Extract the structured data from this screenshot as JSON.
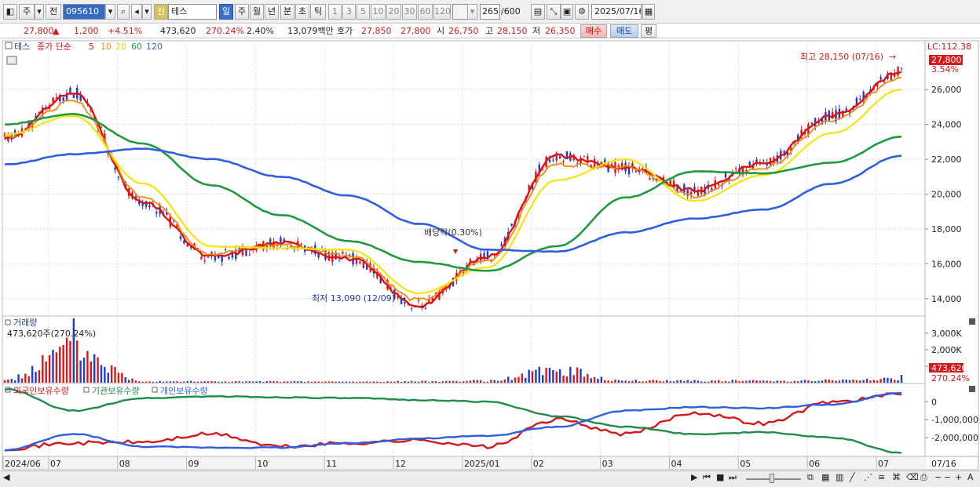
{
  "toolbar": {
    "type_label": "주",
    "prev_label": "전",
    "stock_code": "095610",
    "stock_tag": "신",
    "stock_name": "테스",
    "period_selected": "일",
    "period_tabs": [
      "일",
      "주",
      "월",
      "년",
      "분",
      "초",
      "틱"
    ],
    "interval_tabs": [
      "1",
      "3",
      "5",
      "10",
      "20",
      "30",
      "60",
      "120"
    ],
    "bar_count": "265",
    "bar_total": "/600",
    "date": "2025/07/16"
  },
  "quote": {
    "price": "27,800",
    "change": "1,200",
    "change_pct": "+4.51%",
    "volume": "473,620",
    "volume_pct": "270.24%",
    "turnover_pct": "2.40%",
    "amount": "13,079백만",
    "hoga_label": "호가",
    "ask": "27,850",
    "bid": "27,800",
    "open_label": "시",
    "open": "26,750",
    "high_label": "고",
    "high": "28,150",
    "low_label": "저",
    "low": "26,350",
    "buy_label": "매수",
    "sell_label": "매도",
    "eval_label": "평"
  },
  "price_panel": {
    "name_tag": "테스",
    "legend_title": "종가 단순",
    "ma_periods": [
      "5",
      "10",
      "20",
      "60",
      "120"
    ],
    "ma_colors": [
      "#e01010",
      "#f08a10",
      "#f6e40a",
      "#1f9a3c",
      "#2f5fe0"
    ],
    "lc_label": "LC:112.38",
    "last_price_tag": "27,800",
    "pct_tag": "3.54%",
    "high_note": "최고 28,150 (07/16)",
    "low_note": "최저 13,090 (12/09)",
    "dividend_note": "배당락(0.30%)",
    "y_ticks": [
      "26,000",
      "24,000",
      "22,000",
      "20,000",
      "18,000",
      "16,000",
      "14,000"
    ]
  },
  "volume_panel": {
    "title": "거래량",
    "current": "473,620주(270.24%)",
    "y_ticks": [
      "3,000K",
      "2,000K",
      "1,000K"
    ],
    "last_tag": "473,620",
    "last_pct_tag": "270.24%"
  },
  "holdings_panel": {
    "legend": [
      {
        "label": "외국인보유수량",
        "color": "#d81818"
      },
      {
        "label": "기관보유수량",
        "color": "#1f8c4c"
      },
      {
        "label": "개인보유수량",
        "color": "#2f5fe0"
      }
    ],
    "y_ticks": [
      "0",
      "-1,000,000",
      "-2,000,000"
    ]
  },
  "x_axis": {
    "labels": [
      "2024/06",
      "07",
      "08",
      "09",
      "10",
      "11",
      "12",
      "2025/01",
      "02",
      "03",
      "04",
      "05",
      "06",
      "07"
    ],
    "cursor_date": "07/16"
  },
  "chart_data": [
    {
      "type": "line",
      "title": "",
      "x": [
        "2024/06",
        "07",
        "08",
        "09",
        "10",
        "11",
        "12",
        "2025/01",
        "02",
        "03",
        "04",
        "05",
        "06",
        "07"
      ],
      "series": [
        {
          "name": "5",
          "values": [
            23200,
            25800,
            19500,
            16400,
            17200,
            16300,
            13600,
            16400,
            22200,
            21500,
            20200,
            21800,
            24500,
            27000
          ]
        },
        {
          "name": "10",
          "values": [
            23300,
            25300,
            19900,
            16600,
            17100,
            16500,
            13900,
            16200,
            21700,
            21600,
            19900,
            21500,
            24200,
            26700
          ]
        },
        {
          "name": "20",
          "values": [
            23400,
            24500,
            20600,
            17000,
            16900,
            16800,
            14300,
            15800,
            20800,
            22000,
            19600,
            21100,
            23500,
            26000
          ]
        },
        {
          "name": "60",
          "values": [
            24000,
            24600,
            22900,
            20500,
            18800,
            17300,
            16100,
            15600,
            17000,
            19800,
            21300,
            21200,
            21800,
            23300
          ]
        },
        {
          "name": "120",
          "values": [
            21700,
            22300,
            22600,
            22000,
            21000,
            19900,
            18300,
            16800,
            16700,
            17800,
            18600,
            19100,
            20600,
            22200
          ]
        }
      ],
      "ylim": [
        13000,
        28800
      ]
    },
    {
      "type": "bar",
      "title": "",
      "categories": [
        "2024/06",
        "07",
        "08",
        "09",
        "10",
        "11",
        "12",
        "2025/01",
        "02",
        "03",
        "04",
        "05",
        "06",
        "07"
      ],
      "series": [
        {
          "name": "거래량",
          "values": [
            350000,
            3900000,
            200000,
            150000,
            140000,
            120000,
            160000,
            230000,
            1500000,
            230000,
            260000,
            230000,
            290000,
            473620
          ]
        }
      ],
      "ylim": [
        0,
        3800000
      ]
    },
    {
      "type": "line",
      "title": "",
      "x": [
        "2024/06",
        "07",
        "08",
        "09",
        "10",
        "11",
        "12",
        "2025/01",
        "02",
        "03",
        "04",
        "05",
        "06",
        "07"
      ],
      "series": [
        {
          "name": "외국인보유수량",
          "values": [
            -2600000,
            -2300000,
            -2250000,
            -1800000,
            -2500000,
            -2300000,
            -2150000,
            -2500000,
            -1000000,
            -1800000,
            -600000,
            -1200000,
            0,
            400000
          ]
        },
        {
          "name": "기관보유수량",
          "values": [
            700000,
            -500000,
            200000,
            300000,
            250000,
            200000,
            100000,
            0,
            -800000,
            -1400000,
            -1800000,
            -1700000,
            -2000000,
            -2850000
          ]
        },
        {
          "name": "개인보유수량",
          "values": [
            -2700000,
            -1800000,
            -2500000,
            -2550000,
            -2550000,
            -2300000,
            -2050000,
            -1900000,
            -1400000,
            -500000,
            -300000,
            -350000,
            -150000,
            500000
          ]
        }
      ],
      "ylim": [
        -3000000,
        800000
      ]
    }
  ]
}
